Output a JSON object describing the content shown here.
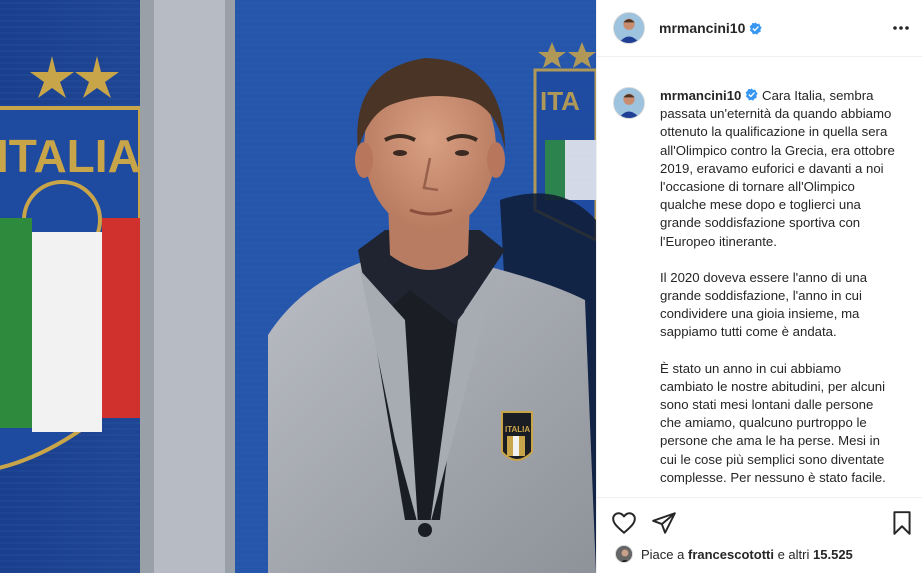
{
  "post": {
    "username": "mrmancini10",
    "verified": true,
    "icons": {
      "more": "more-options-icon",
      "verified": "verified-badge-icon",
      "like": "heart-icon",
      "share": "paper-plane-icon",
      "save": "bookmark-icon"
    }
  },
  "caption": {
    "username": "mrmancini10",
    "paragraphs": [
      "Cara Italia, sembra passata un'eternità da quando abbiamo ottenuto la qualificazione in quella sera all'Olimpico contro la Grecia, era ottobre 2019, eravamo euforici e davanti a noi l'occasione di tornare all'Olimpico qualche mese dopo e toglierci una grande soddisfazione sportiva con l'Europeo itinerante.",
      "Il 2020 doveva essere l'anno di una grande soddisfazione, l'anno in cui condividere una gioia insieme, ma sappiamo tutti come è andata.",
      "È stato un anno in cui abbiamo cambiato le nostre abitudini, per alcuni sono stati mesi lontani dalle persone che amiamo, qualcuno purtroppo le persone che ama le ha perse. Mesi in cui le cose più semplici sono diventate complesse. Per nessuno è stato facile."
    ]
  },
  "likes": {
    "prefix": "Piace a",
    "user": "francescototti",
    "middle": "e altri",
    "count": "15.525"
  },
  "photo": {
    "badge_text": "ITALIA",
    "background_text": "ITALIA",
    "colors": {
      "blue": "#1f4fa8",
      "green": "#2e8b3e",
      "white": "#f2f2f2",
      "red": "#d0312d",
      "gold": "#c9a54a"
    }
  }
}
